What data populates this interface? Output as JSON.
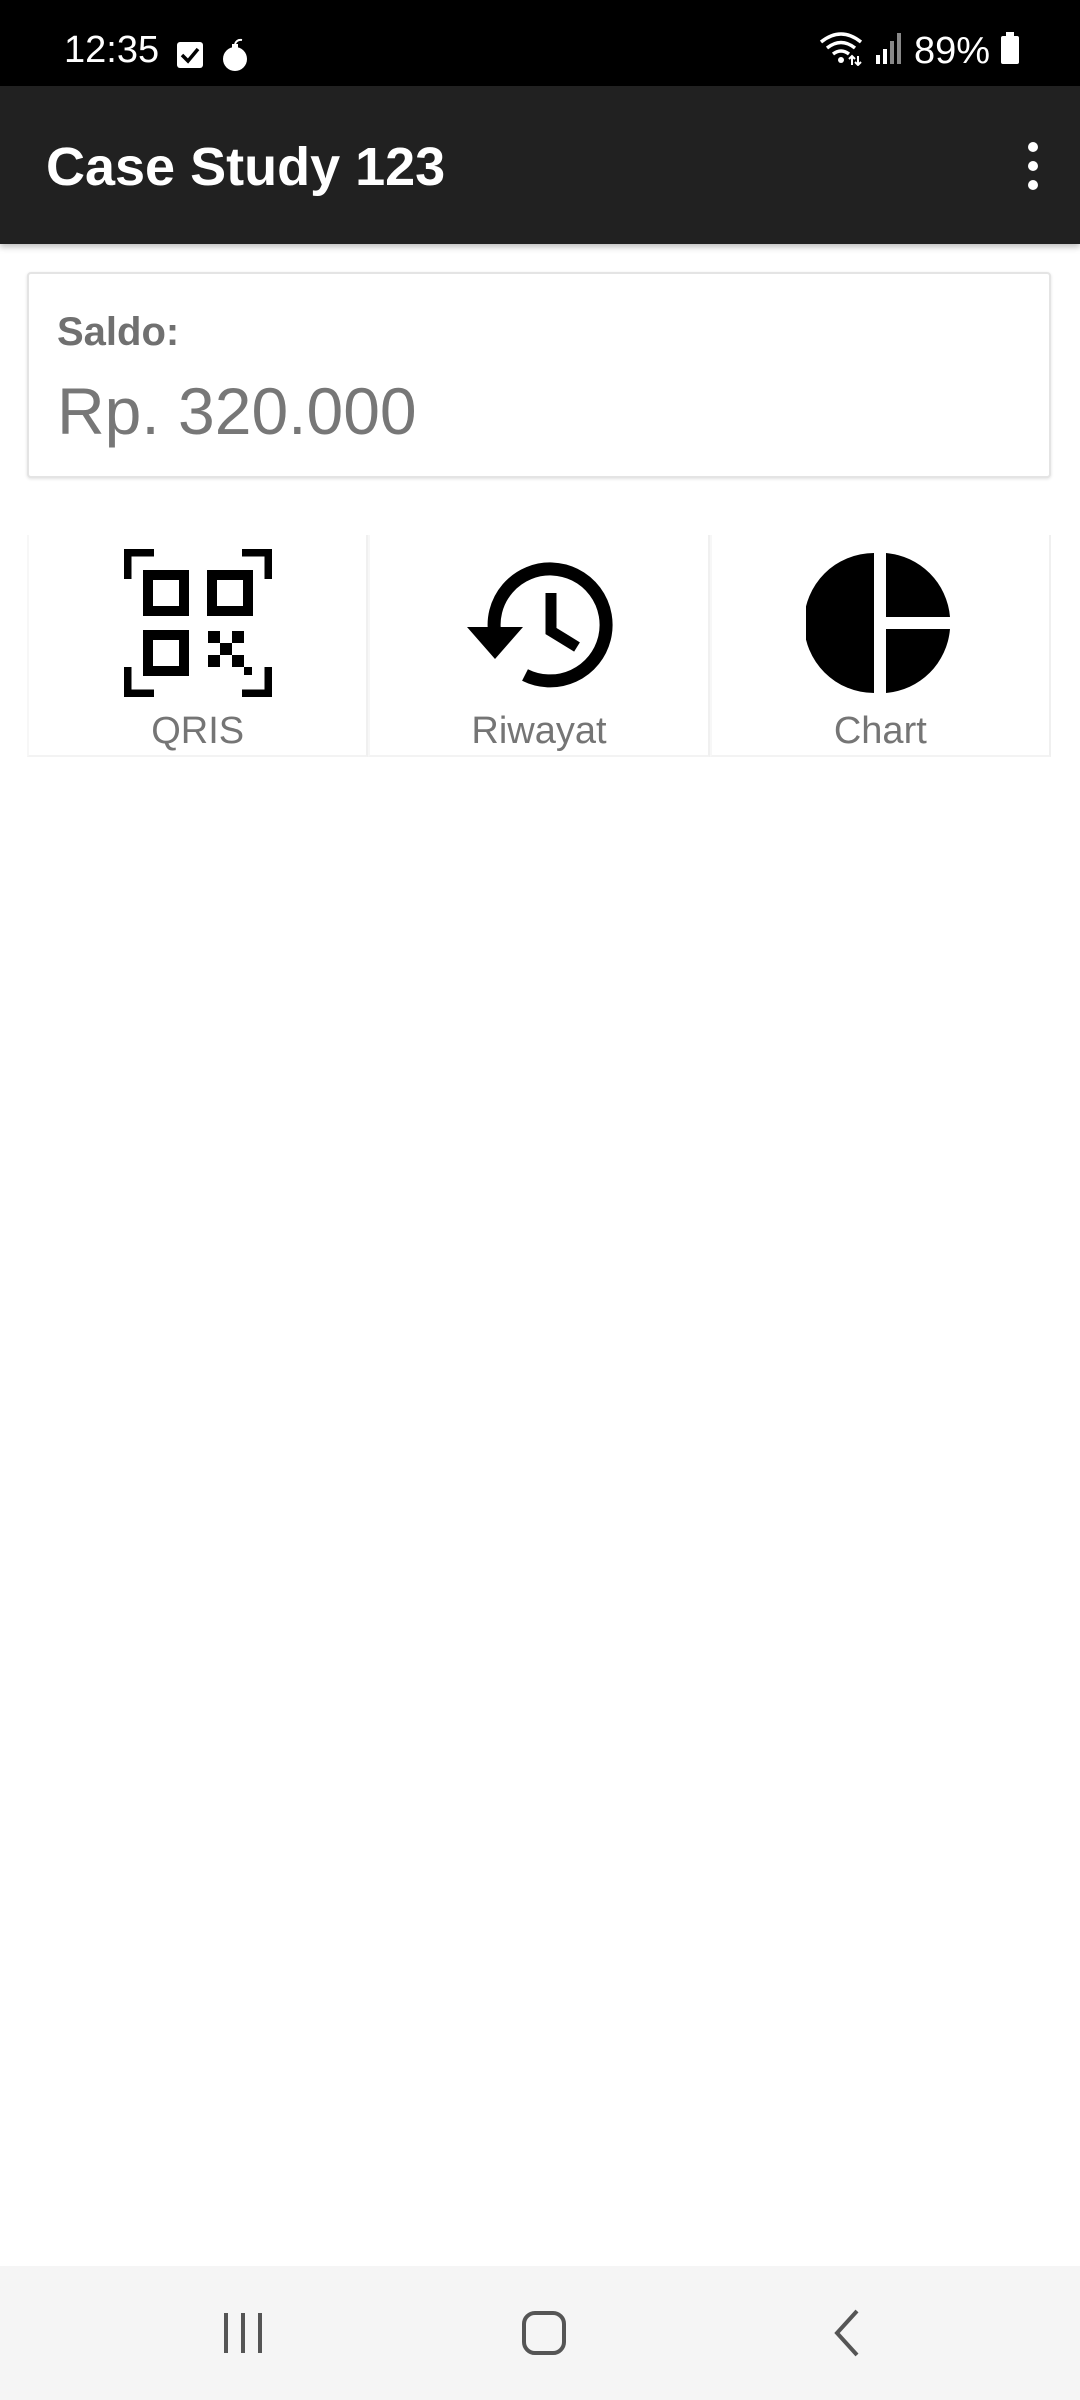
{
  "status_bar": {
    "time": "12:35",
    "battery": "89%",
    "icons_left": [
      "check-notification-icon",
      "bomb-notification-icon"
    ],
    "icons_right": [
      "wifi-icon",
      "signal-icon",
      "battery-icon"
    ]
  },
  "app_bar": {
    "title": "Case Study 123",
    "menu_icon": "more-vert-icon"
  },
  "balance": {
    "label": "Saldo:",
    "value": "Rp. 320.000"
  },
  "menu": {
    "items": [
      {
        "label": "QRIS",
        "icon": "qr-code-icon"
      },
      {
        "label": "Riwayat",
        "icon": "history-icon"
      },
      {
        "label": "Chart",
        "icon": "pie-chart-icon"
      }
    ]
  },
  "nav_bar": {
    "buttons": [
      "recent-apps-icon",
      "home-icon",
      "back-icon"
    ]
  },
  "colors": {
    "status_bar": "#000000",
    "app_bar": "#212121",
    "text_gray": "#757575",
    "nav_bar": "#f5f5f5"
  }
}
